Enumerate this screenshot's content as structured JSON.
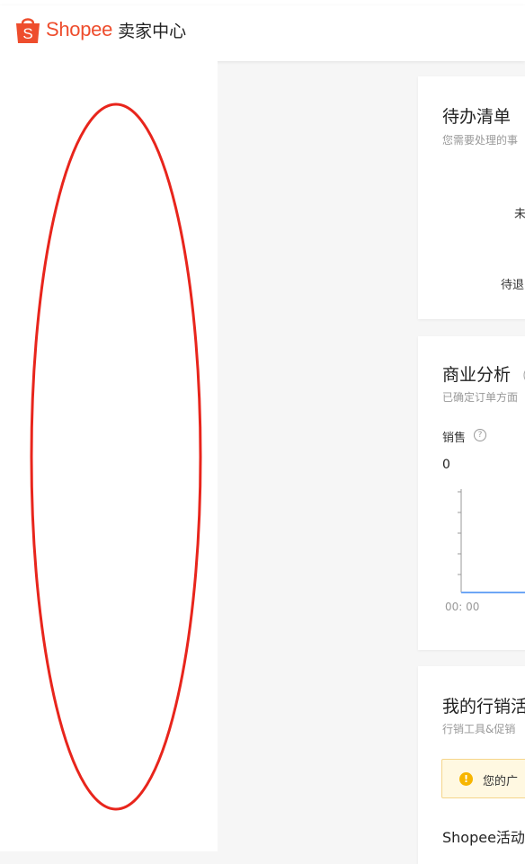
{
  "header": {
    "brand": "Shopee",
    "center_title": "卖家中心",
    "brand_color": "#ee4d2d"
  },
  "todo": {
    "title": "待办清单",
    "subtitle": "您需要处理的事",
    "item_1": "未",
    "item_2": "待退"
  },
  "analytics": {
    "title": "商业分析",
    "title_suffix": "（",
    "subtitle": "已确定订单方面",
    "metric_label": "销售",
    "help_icon": "question-circle-icon",
    "metric_value": "0"
  },
  "chart_data": {
    "type": "line",
    "x_tick_labels": [
      "00: 00"
    ],
    "series": [
      {
        "values": [
          0,
          0
        ]
      }
    ]
  },
  "marketing": {
    "title": "我的行销活",
    "subtitle": "行销工具&促销",
    "notice": "您的广",
    "section": "Shopee活动"
  }
}
